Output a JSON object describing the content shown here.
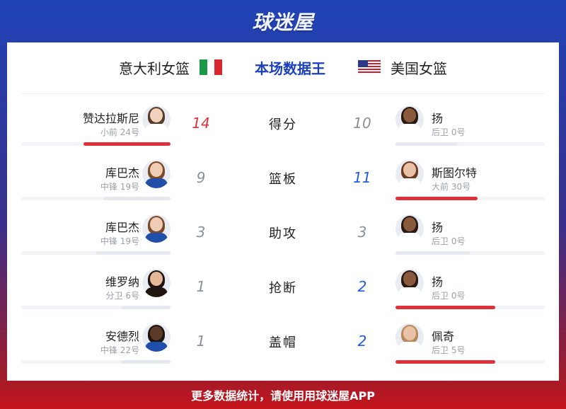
{
  "brand": "球迷屋",
  "header": {
    "team_left": "意大利女篮",
    "title": "本场数据王",
    "team_right": "美国女篮"
  },
  "colors": {
    "win_left": "#e0313a",
    "win_right": "#1f5ee0",
    "bar_win": "#e0313a",
    "bar_lose": "#e4e9f0"
  },
  "rows": [
    {
      "category": "得分",
      "left": {
        "name": "赞达拉斯尼",
        "pos": "小前 24号",
        "value": "14"
      },
      "right": {
        "name": "扬",
        "pos": "后卫 0号",
        "value": "10"
      }
    },
    {
      "category": "篮板",
      "left": {
        "name": "库巴杰",
        "pos": "中锋 19号",
        "value": "9"
      },
      "right": {
        "name": "斯图尔特",
        "pos": "大前 30号",
        "value": "11"
      }
    },
    {
      "category": "助攻",
      "left": {
        "name": "库巴杰",
        "pos": "中锋 19号",
        "value": "3"
      },
      "right": {
        "name": "扬",
        "pos": "后卫 0号",
        "value": "3"
      }
    },
    {
      "category": "抢断",
      "left": {
        "name": "维罗纳",
        "pos": "分卫 6号",
        "value": "1"
      },
      "right": {
        "name": "扬",
        "pos": "后卫 0号",
        "value": "2"
      }
    },
    {
      "category": "盖帽",
      "left": {
        "name": "安德烈",
        "pos": "中锋 22号",
        "value": "1"
      },
      "right": {
        "name": "佩奇",
        "pos": "后卫 5号",
        "value": "2"
      }
    }
  ],
  "footer": "更多数据统计，请使用用球迷屋APP"
}
